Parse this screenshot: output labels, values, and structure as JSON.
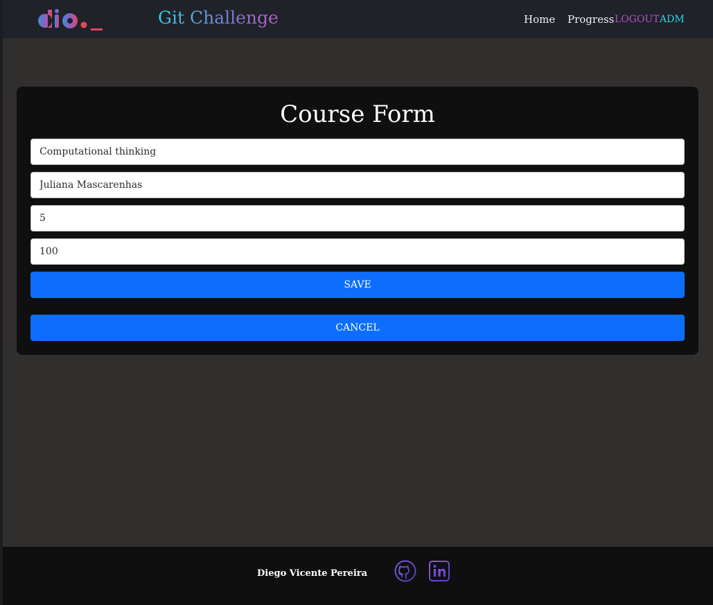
{
  "header": {
    "brand_title": "Git Challenge",
    "logo_icon": "dio-logo",
    "nav": {
      "home": "Home",
      "progress": "Progress",
      "logout": "LOGOUT",
      "adm": "ADM"
    }
  },
  "form": {
    "title": "Course Form",
    "fields": [
      {
        "value": "Computational thinking"
      },
      {
        "value": "Juliana Mascarenhas"
      },
      {
        "value": "5"
      },
      {
        "value": "100"
      }
    ],
    "save_label": "SAVE",
    "cancel_label": "CANCEL"
  },
  "footer": {
    "author": "Diego Vicente Pereira",
    "github_icon": "github-icon",
    "linkedin_icon": "linkedin-icon"
  },
  "colors": {
    "brand_gradient_start": "#3dcbe3",
    "brand_gradient_end": "#b65bc4",
    "logout": "#b44fd0",
    "adm": "#2fd3e6",
    "primary_button": "#0d6efd",
    "logo_accent": "#e7455b"
  }
}
